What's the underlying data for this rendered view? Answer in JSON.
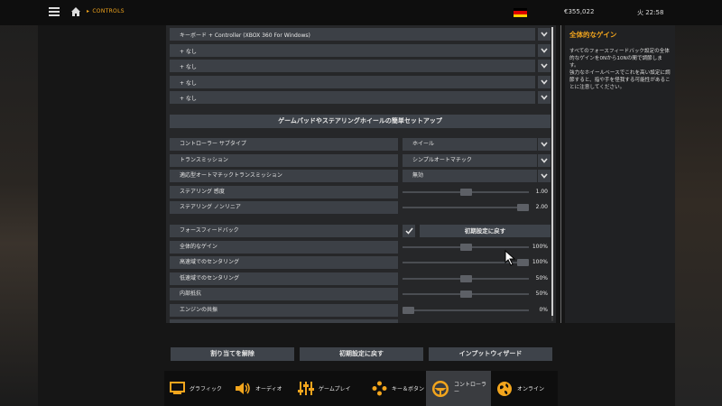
{
  "topbar": {
    "breadcrumb": "CONTROLS",
    "money": "€355,022",
    "time": "火 22:58"
  },
  "controllers": [
    "キーボード + Controller (XBOX 360 For Windows)",
    "+ なし",
    "+ なし",
    "+ なし",
    "+ なし"
  ],
  "setup_button": "ゲームパッドやステアリングホイールの簡単セットアップ",
  "settings": {
    "controller_subtype": {
      "label": "コントローラー サブタイプ",
      "value": "ホイール"
    },
    "transmission": {
      "label": "トランスミッション",
      "value": "シンプルオートマチック"
    },
    "adaptive_auto": {
      "label": "適応型オートマチックトランスミッション",
      "value": "無効"
    },
    "steering_sensitivity": {
      "label": "ステアリング 感度",
      "value": "1.00",
      "level": 0.5
    },
    "steering_nonlinearity": {
      "label": "ステアリング ノンリニア",
      "value": "2.00",
      "level": 1.0
    }
  },
  "force_feedback": {
    "label": "フォースフィードバック",
    "checked": true,
    "reset_label": "初期設定に戻す",
    "rows": [
      {
        "label": "全体的なゲイン",
        "value": "100%",
        "level": 0.5
      },
      {
        "label": "高速域でのセンタリング",
        "value": "100%",
        "level": 1.0
      },
      {
        "label": "低速域でのセンタリング",
        "value": "50%",
        "level": 0.5
      },
      {
        "label": "内部抵抗",
        "value": "50%",
        "level": 0.5
      },
      {
        "label": "エンジンの共振",
        "value": "0%",
        "level": 0.0
      }
    ]
  },
  "bottom_buttons": {
    "unassign": "割り当てを解除",
    "reset": "初期設定に戻す",
    "wizard": "インプットウィザード"
  },
  "help": {
    "title": "全体的なゲイン",
    "text1": "すべてのフォースフィードバック設定の全体的なゲインを0Nから10Nの間で調節します。",
    "text2": "強力なホイールベースでこれを高い設定に調節すると、指や手を怪我する可能性があることに注意してください。"
  },
  "tabs": [
    {
      "label": "グラフィック"
    },
    {
      "label": "オーディオ"
    },
    {
      "label": "ゲームプレイ"
    },
    {
      "label": "キー＆ボタン"
    },
    {
      "label": "コントローラー"
    },
    {
      "label": "オンライン"
    }
  ],
  "colors": {
    "accent": "#f2a51d",
    "row": "#3c4046",
    "panel": "#262729"
  },
  "flag_colors": [
    "#000000",
    "#dd0000",
    "#ffce00"
  ]
}
